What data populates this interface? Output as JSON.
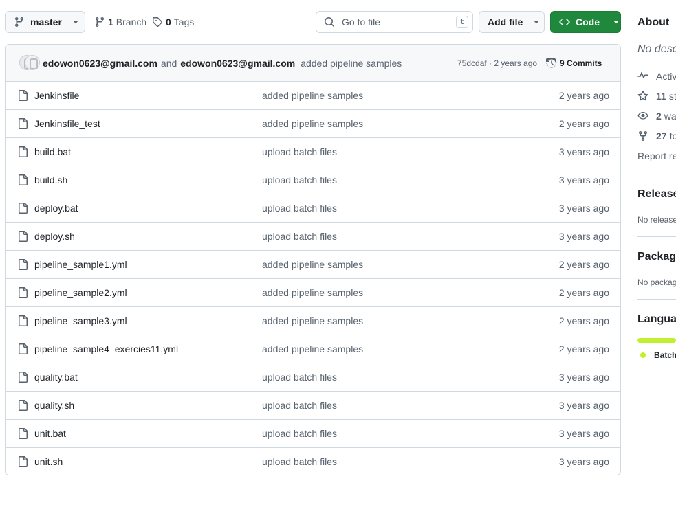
{
  "toolbar": {
    "branch": "master",
    "branches_count": "1",
    "branches_label": "Branch",
    "tags_count": "0",
    "tags_label": "Tags",
    "go_to_file_placeholder": "Go to file",
    "shortcut_key": "t",
    "add_file_label": "Add file",
    "code_label": "Code",
    "code_color": "#1f883d"
  },
  "commit": {
    "author1": "edowon0623@gmail.com",
    "and": "and",
    "author2": "edowon0623@gmail.com",
    "message": "added pipeline samples",
    "meta": "75dcdaf · 2 years ago",
    "commits_label": "9 Commits"
  },
  "files": [
    {
      "name": "Jenkinsfile",
      "message": "added pipeline samples",
      "age": "2 years ago"
    },
    {
      "name": "Jenkinsfile_test",
      "message": "added pipeline samples",
      "age": "2 years ago"
    },
    {
      "name": "build.bat",
      "message": "upload batch files",
      "age": "3 years ago"
    },
    {
      "name": "build.sh",
      "message": "upload batch files",
      "age": "3 years ago"
    },
    {
      "name": "deploy.bat",
      "message": "upload batch files",
      "age": "3 years ago"
    },
    {
      "name": "deploy.sh",
      "message": "upload batch files",
      "age": "3 years ago"
    },
    {
      "name": "pipeline_sample1.yml",
      "message": "added pipeline samples",
      "age": "2 years ago"
    },
    {
      "name": "pipeline_sample2.yml",
      "message": "added pipeline samples",
      "age": "2 years ago"
    },
    {
      "name": "pipeline_sample3.yml",
      "message": "added pipeline samples",
      "age": "2 years ago"
    },
    {
      "name": "pipeline_sample4_exercies11.yml",
      "message": "added pipeline samples",
      "age": "2 years ago"
    },
    {
      "name": "quality.bat",
      "message": "upload batch files",
      "age": "3 years ago"
    },
    {
      "name": "quality.sh",
      "message": "upload batch files",
      "age": "3 years ago"
    },
    {
      "name": "unit.bat",
      "message": "upload batch files",
      "age": "3 years ago"
    },
    {
      "name": "unit.sh",
      "message": "upload batch files",
      "age": "3 years ago"
    }
  ],
  "sidebar": {
    "about_title": "About",
    "description": "No description",
    "activity_label": "Activity",
    "stars_count": "11",
    "stars_label": "stars",
    "watching_count": "2",
    "watching_label": "watching",
    "forks_count": "27",
    "forks_label": "forks",
    "report_label": "Report repository",
    "releases_title": "Releases",
    "releases_text": "No releases published",
    "packages_title": "Packages",
    "packages_text": "No packages published",
    "languages_title": "Languages",
    "language_name": "Batchfile",
    "language_color": "#c1f12e"
  }
}
